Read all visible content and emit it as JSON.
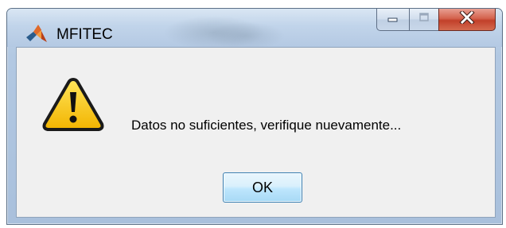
{
  "window": {
    "title": "MFITEC",
    "app_icon": "matlab-logo-icon",
    "controls": {
      "minimize_icon": "minimize-icon",
      "maximize_icon": "maximize-icon",
      "close_icon": "close-icon"
    }
  },
  "dialog": {
    "icon": "warning-icon",
    "message": "Datos no suficientes, verifique nuevamente...",
    "ok_label": "OK"
  },
  "colors": {
    "frame": "#b2c8e2",
    "client_background": "#f0f0f0",
    "close_button": "#c7432c",
    "warning_yellow": "#f6c800",
    "ok_button_border": "#3c7fb1"
  }
}
